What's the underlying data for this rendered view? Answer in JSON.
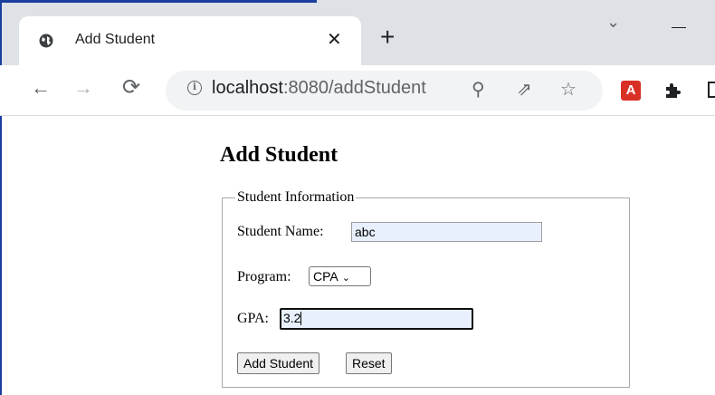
{
  "browser": {
    "tab": {
      "title": "Add Student",
      "close_glyph": "✕"
    },
    "new_tab_glyph": "+",
    "window": {
      "chevron_glyph": "⌄"
    },
    "nav": {
      "back_glyph": "←",
      "forward_glyph": "→",
      "reload_glyph": "⟳"
    },
    "address": {
      "host": "localhost",
      "path": ":8080/addStudent"
    },
    "omnibox_icons": {
      "zoom": "⚲",
      "share": "⇗",
      "bookmark": "☆"
    },
    "extensions": {
      "pdf_label": "A"
    }
  },
  "page": {
    "heading": "Add Student",
    "fieldset_legend": "Student Information",
    "fields": {
      "name_label": "Student Name:",
      "name_value": "abc",
      "program_label": "Program:",
      "program_selected": "CPA",
      "gpa_label": "GPA:",
      "gpa_value": "3.2"
    },
    "buttons": {
      "submit": "Add Student",
      "reset": "Reset"
    }
  },
  "colors": {
    "tab_strip": "#dee1e6",
    "input_autofill": "#e8f0fe",
    "pdf_ext": "#d93025"
  },
  "icons": [
    "globe-icon",
    "close-icon",
    "plus-icon",
    "chevron-down-icon",
    "back-icon",
    "forward-icon",
    "reload-icon",
    "info-icon",
    "zoom-icon",
    "share-icon",
    "star-icon",
    "pdf-icon",
    "puzzle-icon"
  ]
}
